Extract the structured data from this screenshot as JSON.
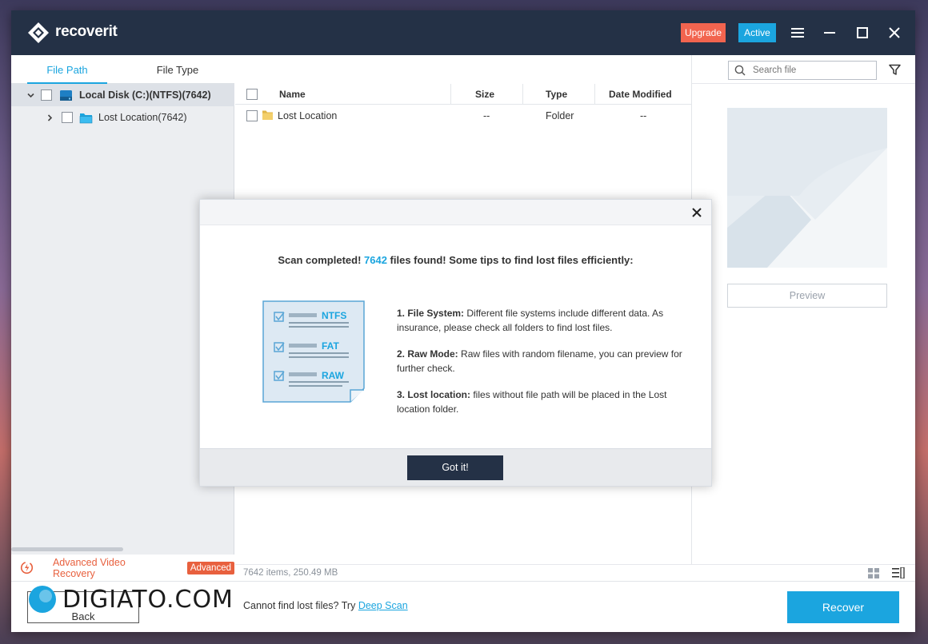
{
  "app": {
    "name_prefix": "recover",
    "name_suffix": "it",
    "upgrade_label": "Upgrade",
    "active_label": "Active"
  },
  "left_panel": {
    "tabs": [
      {
        "label": "File Path",
        "active": true
      },
      {
        "label": "File Type",
        "active": false
      }
    ],
    "tree": [
      {
        "label": "Local Disk (C:)(NTFS)(7642)",
        "expanded": true,
        "selected": true
      },
      {
        "label": "Lost Location(7642)",
        "expanded": false,
        "selected": false
      }
    ],
    "advanced_video_label": "Advanced Video Recovery",
    "advanced_badge": "Advanced"
  },
  "search": {
    "placeholder": "Search file"
  },
  "file_list": {
    "columns": [
      "Name",
      "Size",
      "Type",
      "Date Modified"
    ],
    "rows": [
      {
        "name": "Lost Location",
        "size": "--",
        "type": "Folder",
        "date": "--"
      }
    ]
  },
  "preview": {
    "button_label": "Preview"
  },
  "status": {
    "summary": "7642 items, 250.49  MB"
  },
  "bottom": {
    "back_label": "Back",
    "hint_text": "Cannot find lost files? Try ",
    "deep_scan_label": "Deep Scan",
    "recover_label": "Recover",
    "watermark": "DIGIATO.COM"
  },
  "dialog": {
    "title_before": "Scan completed! ",
    "title_count": "7642",
    "title_after": " files found! Some tips to find lost files efficiently:",
    "illustration_labels": [
      "NTFS",
      "FAT",
      "RAW"
    ],
    "tips": [
      {
        "heading": "1. File System:",
        "text": " Different file systems include different data. As insurance, please check all folders to find lost files."
      },
      {
        "heading": "2. Raw Mode:",
        "text": " Raw files with random filename, you can preview for further check."
      },
      {
        "heading": "3. Lost location:",
        "text": " files without file path will be placed in the Lost location folder."
      }
    ],
    "button_label": "Got it!"
  },
  "colors": {
    "titlebar": "#243146",
    "accent_blue": "#1ba5df",
    "upgrade_red": "#f2644f",
    "advanced_orange": "#e8603e"
  }
}
